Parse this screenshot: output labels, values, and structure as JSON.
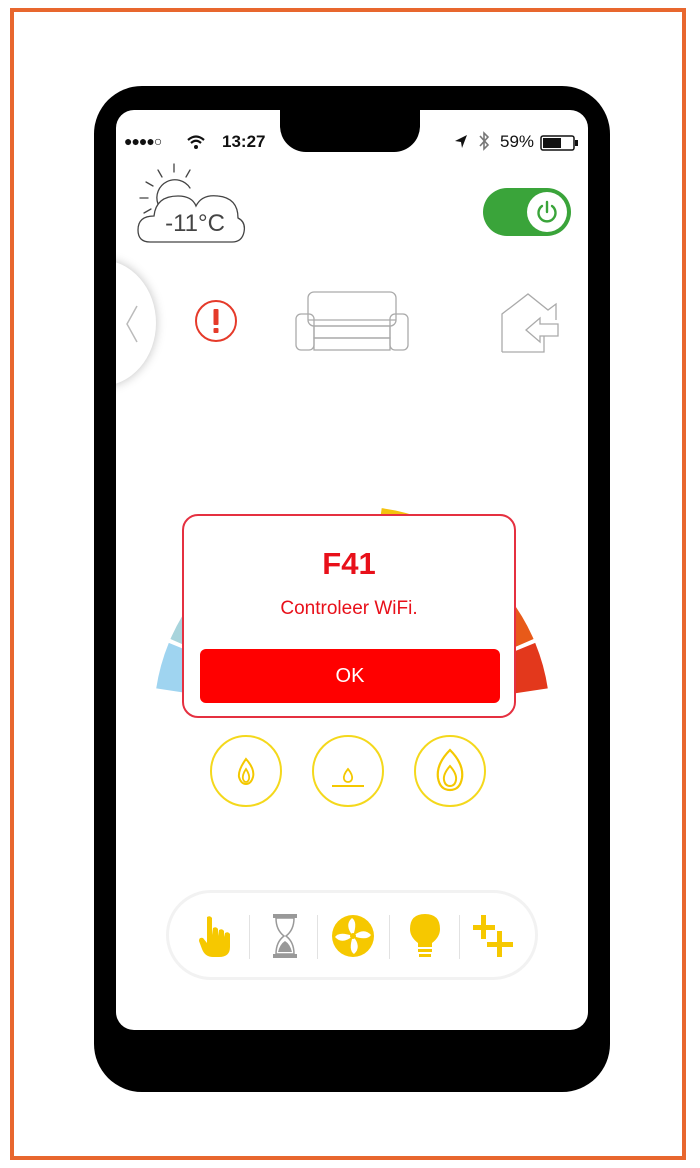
{
  "status_bar": {
    "signal": "●●●●○",
    "time": "13:27",
    "battery": "59%"
  },
  "weather": {
    "temperature": "-11°C",
    "icon": "partly-cloudy-icon"
  },
  "power": {
    "state": "on",
    "icon": "power-icon",
    "color": "#3aa43a"
  },
  "nav": {
    "back_icon": "chevron-left-icon",
    "alert_icon": "exclamation-icon",
    "room_icon": "sofa-icon",
    "home_icon": "home-arrow-icon"
  },
  "dial": {
    "segment_colors": [
      "#9fd4f0",
      "#a8d4dc",
      "#bcd5b4",
      "#cad37a",
      "#ead834",
      "#f5d413",
      "#f4c20e",
      "#f39b12",
      "#ee7a16",
      "#e85a19",
      "#e3381c"
    ]
  },
  "dialog": {
    "code": "F41",
    "message": "Controleer  WiFi.",
    "ok_label": "OK",
    "accent": "#ff0000"
  },
  "modes": [
    {
      "name": "flame-low-icon"
    },
    {
      "name": "pilot-flame-icon"
    },
    {
      "name": "flame-high-icon"
    }
  ],
  "toolbar": {
    "items": [
      "hand-icon",
      "hourglass-icon",
      "fan-icon",
      "bulb-icon",
      "plus-plus-icon"
    ],
    "accent": "#f6c800"
  }
}
